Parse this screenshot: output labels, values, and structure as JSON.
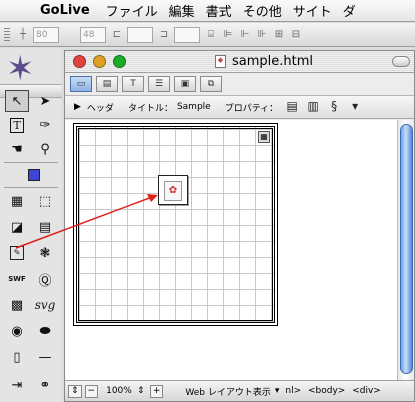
{
  "menubar": {
    "app": "GoLive",
    "items": [
      "ファイル",
      "編集",
      "書式",
      "その他",
      "サイト",
      "ダ"
    ]
  },
  "inspector": {
    "x_value": "80",
    "y_value": "48"
  },
  "palette": {
    "tools": [
      "select-tool",
      "direct-select-tool",
      "text-tool",
      "eyedropper-tool",
      "hand-tool",
      "zoom-tool"
    ],
    "objects": [
      "grid-object",
      "layout-text-box-object",
      "floating-box-object",
      "table-object",
      "plugin-object",
      "quicktime-object",
      "swf-object",
      "realaudio-object",
      "flash-object",
      "svg-object",
      "button-object",
      "line-object",
      "link-object",
      "anchor-object"
    ]
  },
  "window": {
    "title": "sample.html",
    "colors": {
      "close": "#e0443e",
      "minimize": "#dea123",
      "zoom": "#1aab29"
    }
  },
  "headbar": {
    "toggle_label": "ヘッダ",
    "title_label": "タイトル：",
    "title_value": "Sample",
    "property_label": "プロパティ："
  },
  "statusbar": {
    "zoom": "100%",
    "view_mode": "Web レイアウト表示",
    "tags": "nl> <body> <div>"
  },
  "annotation": {
    "arrow_color": "#e0201a"
  }
}
